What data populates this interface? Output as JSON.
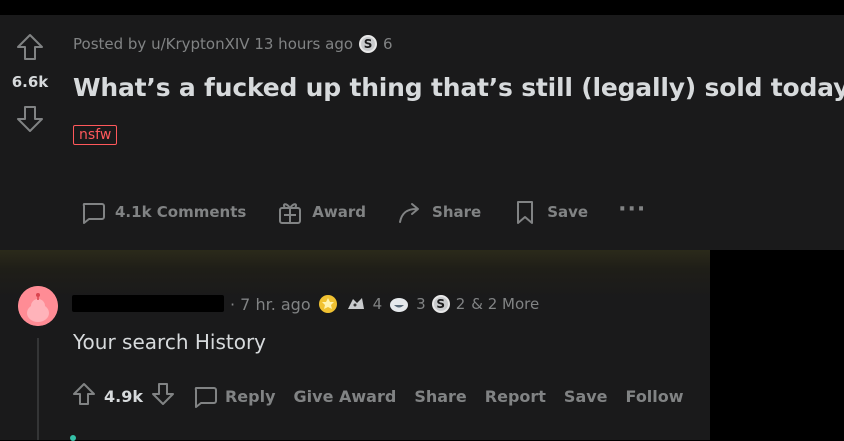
{
  "post": {
    "score": "6.6k",
    "meta": "Posted by u/KryptonXIV 13 hours ago",
    "coin_symbol": "S",
    "coin_count": "6",
    "title": "What’s a fucked up thing that’s still (legally) sold today?",
    "tag": "nsfw",
    "actions": {
      "comments": "4.1k Comments",
      "award": "Award",
      "share": "Share",
      "save": "Save",
      "more": "···"
    }
  },
  "comment": {
    "time": "· 7 hr. ago",
    "award_counts": [
      "4",
      "3",
      "2"
    ],
    "coin_symbol": "S",
    "more": "& 2 More",
    "body": "Your search History",
    "score": "4.9k",
    "actions": {
      "reply": "Reply",
      "give_award": "Give Award",
      "share": "Share",
      "report": "Report",
      "save": "Save",
      "follow": "Follow"
    }
  }
}
